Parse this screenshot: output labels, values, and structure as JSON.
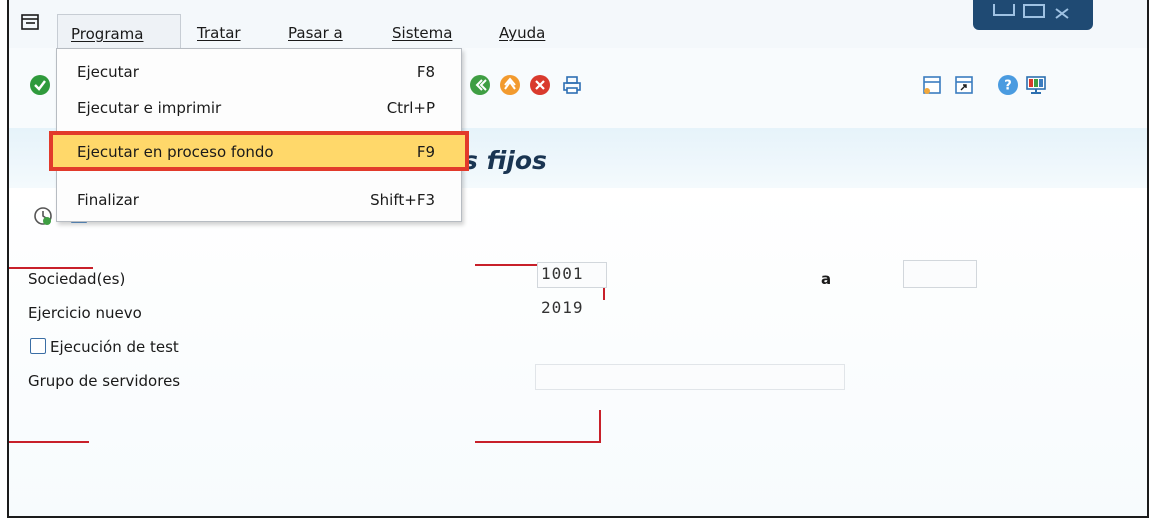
{
  "menubar": {
    "items": [
      {
        "label": "Programa"
      },
      {
        "label": "Tratar"
      },
      {
        "label": "Pasar a"
      },
      {
        "label": "Sistema"
      },
      {
        "label": "Ayuda"
      }
    ]
  },
  "dropdown": {
    "items": [
      {
        "label": "Ejecutar",
        "shortcut": "F8"
      },
      {
        "label": "Ejecutar e imprimir",
        "shortcut": "Ctrl+P"
      },
      {
        "label": "Ejecutar en proceso fondo",
        "shortcut": "F9"
      },
      {
        "label": "Finalizar",
        "shortcut": "Shift+F3"
      }
    ]
  },
  "page": {
    "title_fragment": "s fijos"
  },
  "form": {
    "sociedad_label": "Sociedad(es)",
    "sociedad_value": "1001",
    "to_label": "a",
    "to_value": "",
    "ejercicio_label": "Ejercicio nuevo",
    "ejercicio_value": "2019",
    "test_label": "Ejecución de test",
    "grupo_label": "Grupo de servidores",
    "grupo_value": ""
  },
  "colors": {
    "highlight_bg": "#ffd86a",
    "highlight_border": "#e23a2b",
    "title": "#1a3552"
  }
}
